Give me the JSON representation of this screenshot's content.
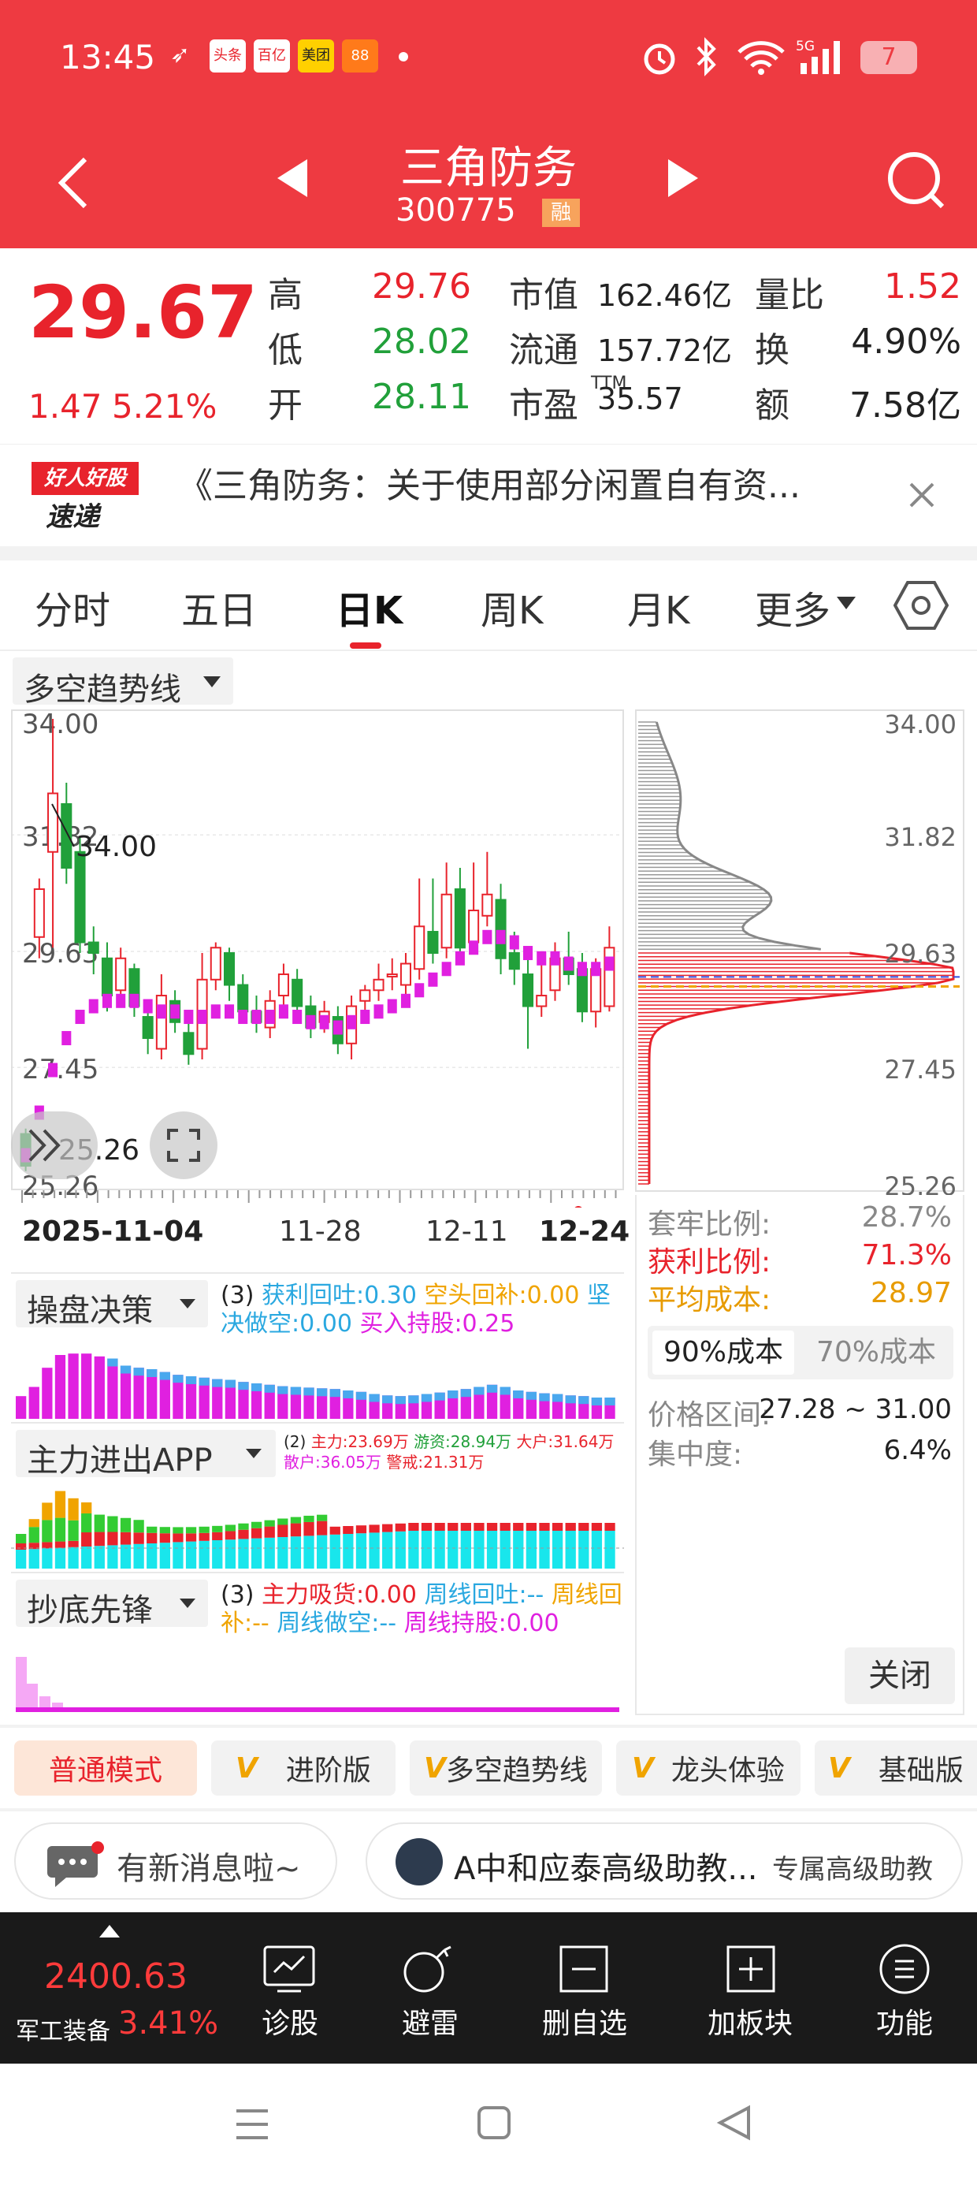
{
  "status": {
    "time": "13:45",
    "app_icons": [
      "头条",
      "百亿",
      "美团",
      "88"
    ],
    "battery": "7"
  },
  "nav": {
    "title": "三角防务",
    "code": "300775",
    "margin_badge": "融"
  },
  "quote": {
    "price": "29.67",
    "change": "1.47",
    "change_pct": "5.21%",
    "rows": [
      {
        "l1": "高",
        "v1": "29.76",
        "l2": "市值",
        "v2": "162.46亿",
        "l3": "量比",
        "v3": "1.52"
      },
      {
        "l1": "低",
        "v1": "28.02",
        "l2": "流通",
        "v2": "157.72亿",
        "l3": "换",
        "v3": "4.90%"
      },
      {
        "l1": "开",
        "v1": "28.11",
        "l2": "市盈",
        "l2sup": "TTM",
        "v2": "35.57",
        "l3": "额",
        "v3": "7.58亿"
      }
    ]
  },
  "news": {
    "logo_top": "好人好股",
    "logo_bottom": "速递",
    "headline": "《三角防务：关于使用部分闲置自有资..."
  },
  "tabs": [
    "分时",
    "五日",
    "日K",
    "周K",
    "月K",
    "更多"
  ],
  "indicator_select": "多空趋势线",
  "kline": {
    "y_labels": [
      "34.00",
      "31.82",
      "29.63",
      "27.45",
      "25.26"
    ],
    "high_marker": "34.00",
    "low_marker": "25.26",
    "x_labels": [
      "2025-11-04",
      "11-28",
      "12-11",
      "12-24"
    ]
  },
  "cost": {
    "y_labels": [
      "34.00",
      "31.82",
      "29.63",
      "27.45",
      "25.26"
    ],
    "rows": [
      {
        "label": "套牢比例:",
        "value": "28.7%"
      },
      {
        "label": "获利比例:",
        "value": "71.3%"
      },
      {
        "label": "平均成本:",
        "value": "28.97"
      }
    ],
    "tabs": [
      "90%成本",
      "70%成本"
    ],
    "range_label": "价格区间:",
    "range_value": "27.28 ~ 31.00",
    "conc_label": "集中度:",
    "conc_value": "6.4%",
    "close": "关闭"
  },
  "ind1": {
    "name": "操盘决策",
    "p": "(3)",
    "items": [
      {
        "t": "获利回吐:0.30",
        "c": "#2aa8e0"
      },
      {
        "t": "空头回补:0.00",
        "c": "#f0a400"
      },
      {
        "t": "坚决做空:0.00",
        "c": "#2aa8e0"
      },
      {
        "t": "买入持股:0.25",
        "c": "#e020e0"
      }
    ],
    "values": [
      0.32,
      0.45,
      0.72,
      0.9,
      0.92,
      0.92,
      0.88,
      0.85,
      0.75,
      0.72,
      0.7,
      0.66,
      0.62,
      0.6,
      0.58,
      0.56,
      0.55,
      0.52,
      0.5,
      0.48,
      0.46,
      0.45,
      0.44,
      0.43,
      0.42,
      0.4,
      0.38,
      0.35,
      0.33,
      0.32,
      0.33,
      0.35,
      0.37,
      0.4,
      0.42,
      0.45,
      0.48,
      0.45,
      0.4,
      0.38,
      0.36,
      0.35,
      0.33,
      0.32,
      0.3,
      0.3
    ]
  },
  "ind2": {
    "name": "主力进出APP",
    "p": "(2)",
    "line1": [
      {
        "t": "主力:23.69万",
        "c": "#e8232c"
      },
      {
        "t": "游资:28.94万",
        "c": "#21a03a"
      },
      {
        "t": "大户:31.64万",
        "c": "#e8232c"
      }
    ],
    "line2": [
      {
        "t": "散户:36.05万",
        "c": "#e020e0"
      },
      {
        "t": "警戒:21.31万",
        "c": "#e8232c"
      }
    ]
  },
  "ind3": {
    "name": "抄底先锋",
    "p": "(3)",
    "items": [
      {
        "t": "主力吸货:0.00",
        "c": "#e8232c"
      },
      {
        "t": "周线回吐:--",
        "c": "#2aa8e0"
      },
      {
        "t": "周线回补:--",
        "c": "#f0a400"
      },
      {
        "t": "周线做空:--",
        "c": "#2aa8e0"
      },
      {
        "t": "周线持股:0.00",
        "c": "#e020e0"
      }
    ]
  },
  "modes": [
    "普通模式",
    "进阶版",
    "多空趋势线",
    "龙头体验",
    "基础版"
  ],
  "msg": {
    "left": "有新消息啦~",
    "right": "A中和应泰高级助教...",
    "right_tag": "专属高级助教"
  },
  "bottom": {
    "index_value": "2400.63",
    "index_name": "军工装备",
    "index_pct": "3.41%",
    "items": [
      "诊股",
      "避雷",
      "删自选",
      "加板块",
      "功能"
    ]
  },
  "colors": {
    "red": "#e8232c",
    "green": "#21a03a",
    "header": "#ee3a41"
  }
}
